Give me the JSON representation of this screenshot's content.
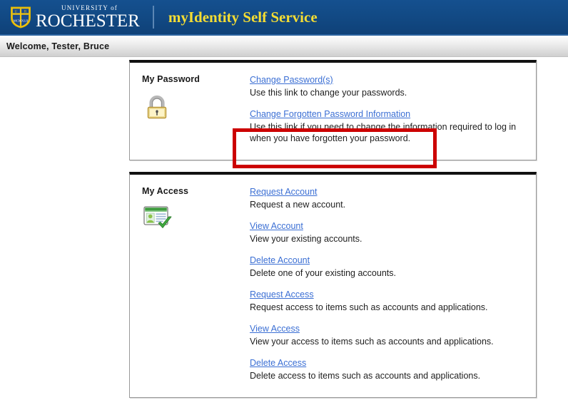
{
  "header": {
    "logo_university": "UNIVERSITY of",
    "logo_name": "ROCHESTER",
    "app_title": "myIdentity Self Service",
    "logo_icon": "university-shield-icon",
    "divider": "vertical-divider"
  },
  "welcome": {
    "text": "Welcome, Tester, Bruce"
  },
  "panels": [
    {
      "id": "my-password",
      "title": "My Password",
      "icon": "padlock-icon",
      "items": [
        {
          "link": "Change Password(s)",
          "desc": "Use this link to change your passwords."
        },
        {
          "link": "Change Forgotten Password Information",
          "desc": "Use this link if you need to change the information required to log in when you have forgotten your password."
        }
      ]
    },
    {
      "id": "my-access",
      "title": "My Access",
      "icon": "id-card-check-icon",
      "items": [
        {
          "link": "Request Account",
          "desc": "Request a new account."
        },
        {
          "link": "View Account",
          "desc": "View your existing accounts."
        },
        {
          "link": "Delete Account",
          "desc": "Delete one of your existing accounts."
        },
        {
          "link": "Request Access",
          "desc": "Request access to items such as accounts and applications."
        },
        {
          "link": "View Access",
          "desc": "View your access to items such as accounts and applications."
        },
        {
          "link": "Delete Access",
          "desc": "Delete access to items such as accounts and applications."
        }
      ]
    }
  ],
  "highlight": {
    "name": "red-highlight-box",
    "color": "#cc0000",
    "target": "Change Password(s)"
  },
  "colors": {
    "header_blue": "#134a84",
    "title_gold": "#f5dd33",
    "link_blue": "#3b6fd4",
    "highlight_red": "#cc0000",
    "panel_border_top": "#111111"
  }
}
